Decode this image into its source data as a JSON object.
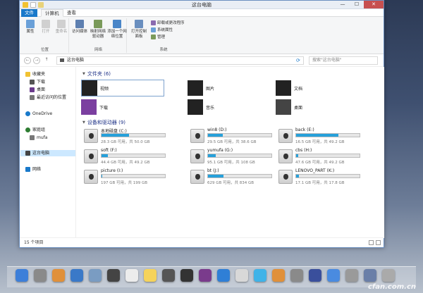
{
  "window": {
    "title": "这台电脑",
    "controls": [
      "—",
      "☐",
      "✕"
    ]
  },
  "ribbon_tabs": [
    "文件",
    "计算机",
    "查看"
  ],
  "ribbon": {
    "groups": [
      {
        "label": "位置",
        "buttons": [
          "属性",
          "打开",
          "重命名"
        ]
      },
      {
        "label": "网络",
        "buttons": [
          "访问媒体",
          "映射网络驱动器",
          "添加一个网络位置"
        ]
      },
      {
        "label": "系统",
        "buttons": [
          "打开控制面板"
        ],
        "small": [
          "卸载或更改程序",
          "系统属性",
          "管理"
        ]
      }
    ]
  },
  "address": {
    "path": "这台电脑",
    "search_placeholder": "搜索\"这台电脑\"",
    "refresh_icon": "refresh-icon"
  },
  "sidebar": {
    "items": [
      {
        "label": "收藏夹",
        "icon": "star-icon",
        "color": "#f1c232"
      },
      {
        "label": "下载",
        "icon": "download-folder-icon",
        "color": "#555"
      },
      {
        "label": "桌面",
        "icon": "desktop-icon",
        "color": "#6a3b8c"
      },
      {
        "label": "最近访问的位置",
        "icon": "recent-icon",
        "color": "#777"
      },
      {
        "label": "OneDrive",
        "icon": "cloud-icon",
        "color": "#1979ca"
      },
      {
        "label": "家庭组",
        "icon": "homegroup-icon",
        "color": "#2e7d32"
      },
      {
        "label": "mufa",
        "icon": "user-icon",
        "color": "#777"
      },
      {
        "label": "这台电脑",
        "icon": "computer-icon",
        "color": "#444"
      },
      {
        "label": "网络",
        "icon": "network-icon",
        "color": "#1979ca"
      }
    ]
  },
  "folders_section": {
    "heading": "文件夹 (6)",
    "items": [
      {
        "label": "视频",
        "color": "#222"
      },
      {
        "label": "图片",
        "color": "#222"
      },
      {
        "label": "文档",
        "color": "#222"
      },
      {
        "label": "下载",
        "color": "#7b3fa0"
      },
      {
        "label": "音乐",
        "color": "#222"
      },
      {
        "label": "桌面",
        "color": "#444"
      }
    ]
  },
  "drives_section": {
    "heading": "设备和驱动器 (9)",
    "items": [
      {
        "name": "本地磁盘 (C:)",
        "free": "28.3 GB 可用，共 50.0 GB",
        "used": 0.434
      },
      {
        "name": "win8 (D:)",
        "free": "29.5 GB 可用，共 38.6 GB",
        "used": 0.236
      },
      {
        "name": "back (E:)",
        "free": "16.5 GB 可用，共 49.2 GB",
        "used": 0.665
      },
      {
        "name": "soft (F:)",
        "free": "44.4 GB 可用，共 49.2 GB",
        "used": 0.098
      },
      {
        "name": "yumufa (G:)",
        "free": "95.1 GB 可用，共 108 GB",
        "used": 0.119
      },
      {
        "name": "cbs (H:)",
        "free": "47.6 GB 可用，共 49.2 GB",
        "used": 0.033
      },
      {
        "name": "picture (I:)",
        "free": "197 GB 可用，共 199 GB",
        "used": 0.01
      },
      {
        "name": "bt (J:)",
        "free": "629 GB 可用，共 834 GB",
        "used": 0.246
      },
      {
        "name": "LENOVO_PART (K:)",
        "free": "17.1 GB 可用，共 17.8 GB",
        "used": 0.039
      }
    ]
  },
  "statusbar": {
    "count": "15 个项目"
  },
  "dock": {
    "icons": [
      {
        "name": "finder-icon",
        "color": "#3d7fd9"
      },
      {
        "name": "system-preferences-icon",
        "color": "#8a8a8a"
      },
      {
        "name": "photos-icon",
        "color": "#e0903a"
      },
      {
        "name": "xcode-icon",
        "color": "#3a79c8"
      },
      {
        "name": "grapher-icon",
        "color": "#7a9cc2"
      },
      {
        "name": "quicktime-icon",
        "color": "#444"
      },
      {
        "name": "textedit-icon",
        "color": "#ececec"
      },
      {
        "name": "notes-icon",
        "color": "#f5d35b"
      },
      {
        "name": "app-icon",
        "color": "#555"
      },
      {
        "name": "terminal-icon",
        "color": "#333"
      },
      {
        "name": "x-app-icon",
        "color": "#7a3b8c"
      },
      {
        "name": "app-store-icon",
        "color": "#2f7fd6"
      },
      {
        "name": "icloud-icon",
        "color": "#d8d8d8"
      },
      {
        "name": "music-icon",
        "color": "#3fb3e8"
      },
      {
        "name": "tools-icon",
        "color": "#e0903a"
      },
      {
        "name": "sync-icon",
        "color": "#8a8a8a"
      },
      {
        "name": "itunes-icon",
        "color": "#3a4f9c"
      },
      {
        "name": "app-store-2-icon",
        "color": "#4a8be0"
      },
      {
        "name": "settings-icon",
        "color": "#9a9a9a"
      },
      {
        "name": "folder-icon",
        "color": "#6a7fa8"
      },
      {
        "name": "trash-icon",
        "color": "#aaa"
      }
    ]
  },
  "watermark": "cfan.com.cn"
}
